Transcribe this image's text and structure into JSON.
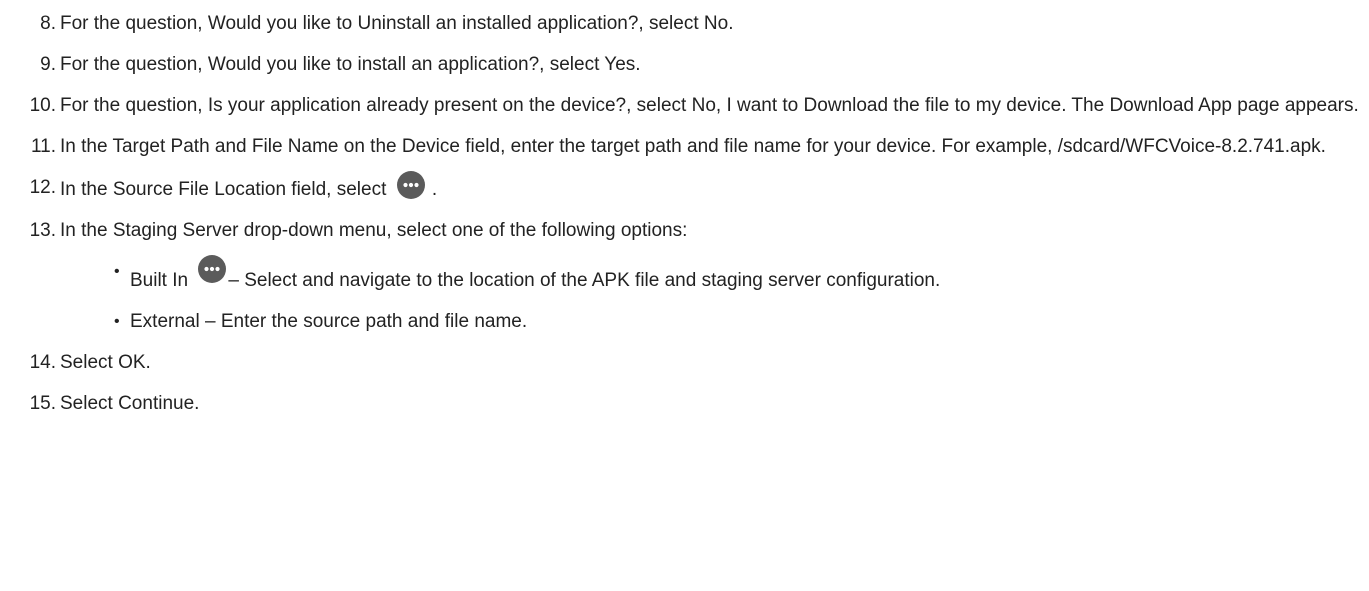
{
  "steps": [
    {
      "num": "8.",
      "text": "For the question, Would you like to Uninstall an installed application?, select No."
    },
    {
      "num": "9.",
      "text": "For the question, Would you like to install an application?, select Yes."
    },
    {
      "num": "10.",
      "text": "For the question, Is your application already present on the device?, select No, I want to Download the file to my device. The Download App page appears."
    },
    {
      "num": "11.",
      "text": "In the Target Path and File Name on the Device field, enter the target path and file name for your device. For example, /sdcard/WFCVoice-8.2.741.apk."
    },
    {
      "num": "12.",
      "text_before": "In the Source File Location field, select",
      "text_after": "."
    },
    {
      "num": "13.",
      "text": "In the Staging Server drop-down menu, select one of the following options:",
      "options": [
        {
          "bullet": "•",
          "text_before": "Built In",
          "text_after": "– Select and navigate to the location of the APK file and staging server configuration."
        },
        {
          "bullet": "•",
          "text": "External – Enter the source path and file name."
        }
      ]
    },
    {
      "num": "14.",
      "text": "Select OK."
    },
    {
      "num": "15.",
      "text": "Select Continue."
    }
  ],
  "icons": {
    "more": {
      "name": "more-options-icon",
      "color": "#5b5b5b",
      "dot_color": "#ffffff"
    }
  }
}
